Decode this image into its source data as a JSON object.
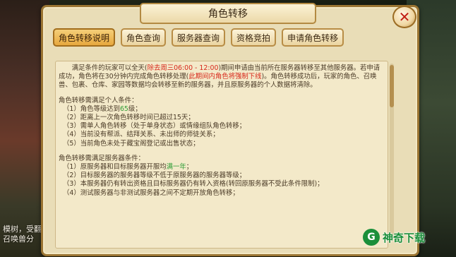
{
  "window": {
    "title": "角色转移",
    "close_symbol": "✕"
  },
  "tabs": [
    {
      "label": "角色转移说明",
      "active": true
    },
    {
      "label": "角色查询",
      "active": false
    },
    {
      "label": "服务器查询",
      "active": false
    },
    {
      "label": "资格竞拍",
      "active": false
    },
    {
      "label": "申请角色转移",
      "active": false
    }
  ],
  "intro": {
    "p1": "满足条件的玩家可以全天(",
    "red1": "除去周三06:00 - 12:00",
    "p2": ")期间申请由当前所在服务器转移至其他服务器。若申请成功，角色将在30分钟内完成角色转移处理(",
    "red2": "此期间内角色将强制下线",
    "p3": ")。角色转移成功后，玩家的角色、召唤兽、包裹、仓库、家园等数据均会转移至新的服务器，并且原服务器的个人数据将清除。"
  },
  "personal": {
    "heading": "角色转移需满足个人条件：",
    "i1_pre": "（1）角色等级达到",
    "i1_hl": "65",
    "i1_post": "级；",
    "i2": "（2）距离上一次角色转移时间已超过15天；",
    "i3": "（3）需单人角色转移（处于单身状态）或情缘组队角色转移；",
    "i4": "（4）当前没有帮派、结拜关系、未出师的师徒关系；",
    "i5": "（5）当前角色未处于藏宝阁登记或出售状态；"
  },
  "server": {
    "heading": "角色转移需满足服务器条件：",
    "i1_pre": "（1）原服务器和目标服务器开服均",
    "i1_hl": "满一年",
    "i1_post": "；",
    "i2": "（2）目标服务器的服务器等级不低于原服务器的服务器等级；",
    "i3": "（3）本服务器仍有转出资格且目标服务器仍有转入资格(转回原服务器不受此条件限制)；",
    "i4": "（4）测试服务器与非测试服务器之间不定期开放角色转移；"
  },
  "background": {
    "chat_line1": "模树，受翻",
    "chat_line2": "召唤兽分"
  },
  "watermark": {
    "icon": "G",
    "text": "神奇下载"
  }
}
